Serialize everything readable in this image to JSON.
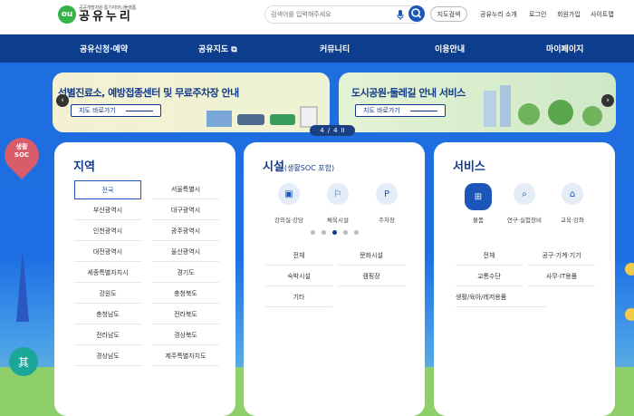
{
  "header": {
    "logo_mark": "ou",
    "logo_sub": "공공개방자원 통기자마니플랫폼",
    "logo_main": "공유누리",
    "search_placeholder": "검색어를 입력해주세요",
    "map_search": "지도검색",
    "util_links": [
      "공유누리 소개",
      "로그인",
      "회원가입",
      "사이트맵"
    ]
  },
  "nav": [
    "공유신청·예약",
    "공유지도 ⧉",
    "커뮤니티",
    "이용안내",
    "마이페이지"
  ],
  "side": {
    "pin_label": "생활SOC",
    "circle_label": "其"
  },
  "banners": [
    {
      "title": "선별진료소, 예방접종센터 및 무료주차장 안내",
      "link": "지도 바로가기"
    },
    {
      "title": "도시공원·둘레길 안내 서비스",
      "link": "지도 바로가기"
    }
  ],
  "pager": {
    "current": "4",
    "total": "4",
    "sep": "/",
    "pause": "II"
  },
  "region_card": {
    "title": "지역",
    "regions": [
      "전국",
      "서울특별시",
      "부산광역시",
      "대구광역시",
      "인천광역시",
      "광주광역시",
      "대전광역시",
      "울산광역시",
      "세종특별자치시",
      "경기도",
      "강원도",
      "충청북도",
      "충청남도",
      "전라북도",
      "전라남도",
      "경상북도",
      "경상남도",
      "제주특별자치도"
    ],
    "selected": "전국"
  },
  "facility_card": {
    "title": "시설",
    "title_sub": "(생활SOC 포함)",
    "icons": [
      {
        "icon": "lecture-room-icon",
        "label": "강의실·강당"
      },
      {
        "icon": "sports-facility-icon",
        "label": "체육시설"
      },
      {
        "icon": "parking-icon",
        "label": "주차장"
      }
    ],
    "dots": 5,
    "active_dot": 3,
    "categories": [
      "전체",
      "문화시설",
      "숙박시설",
      "캠핑장",
      "기타"
    ]
  },
  "service_card": {
    "title": "서비스",
    "icons": [
      {
        "icon": "gift-icon",
        "label": "물품",
        "selected": true
      },
      {
        "icon": "microscope-icon",
        "label": "연구·실험장비",
        "selected": false
      },
      {
        "icon": "graduation-cap-icon",
        "label": "교육·강좌",
        "selected": false
      }
    ],
    "categories": [
      "전체",
      "공구·기계·기기",
      "교통수단",
      "사무·IT용품",
      "생활/육아/레저용품"
    ]
  },
  "colors": {
    "primary": "#1c56b8",
    "nav": "#0d3e8e",
    "title": "#123a8a"
  }
}
